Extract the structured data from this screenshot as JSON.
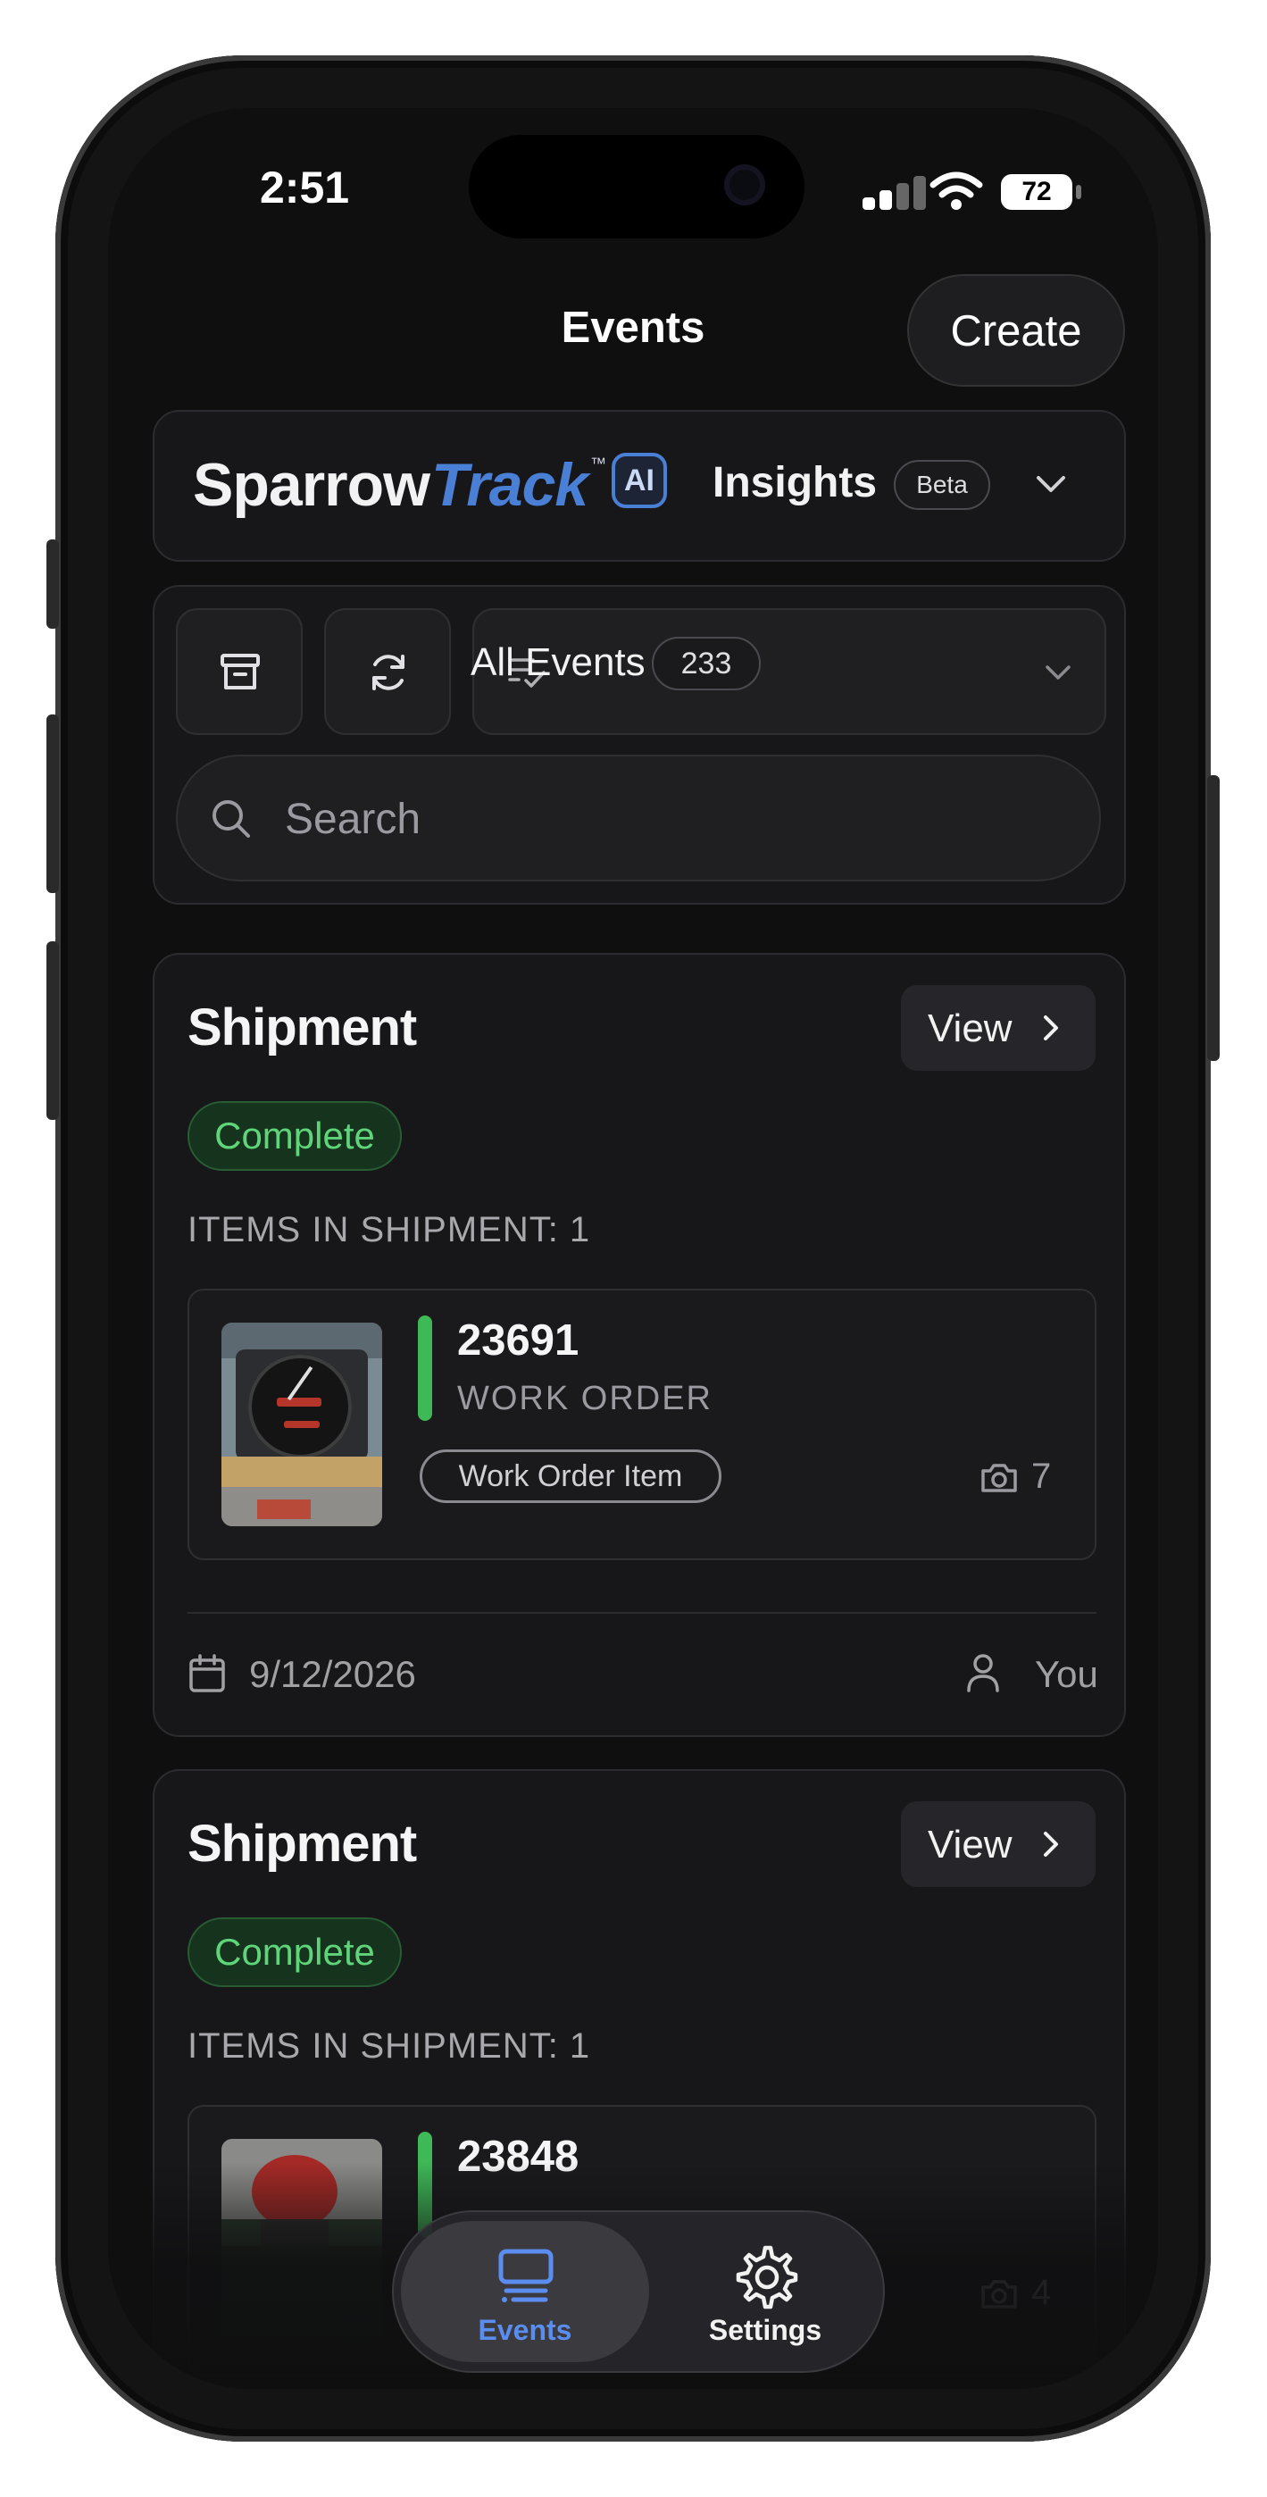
{
  "status_bar": {
    "time": "2:51",
    "battery": "72"
  },
  "header": {
    "title": "Events",
    "create_label": "Create"
  },
  "brand": {
    "name_part1": "Sparrow",
    "name_part2": "Track",
    "trademark": "™",
    "ai_badge": "AI",
    "insights_label": "Insights",
    "beta_label": "Beta"
  },
  "filters": {
    "scope_label": "All Events",
    "count": "233"
  },
  "search": {
    "placeholder": "Search"
  },
  "cards": [
    {
      "title": "Shipment",
      "view_label": "View",
      "status": "Complete",
      "items_label": "ITEMS IN SHIPMENT: 1",
      "item": {
        "number": "23691",
        "type": "WORK ORDER",
        "tag": "Work Order Item",
        "photo_count": "7"
      },
      "date": "9/12/2026",
      "user": "You"
    },
    {
      "title": "Shipment",
      "view_label": "View",
      "status": "Complete",
      "items_label": "ITEMS IN SHIPMENT: 1",
      "item": {
        "number": "23848",
        "photo_count": "4"
      }
    }
  ],
  "tabbar": {
    "tabs": [
      {
        "label": "Events",
        "active": true
      },
      {
        "label": "Settings",
        "active": false
      }
    ]
  },
  "colors": {
    "accent": "#4a7fd6",
    "success": "#3fb857",
    "background": "#0f0f10",
    "active_tab": "#5b8def"
  }
}
